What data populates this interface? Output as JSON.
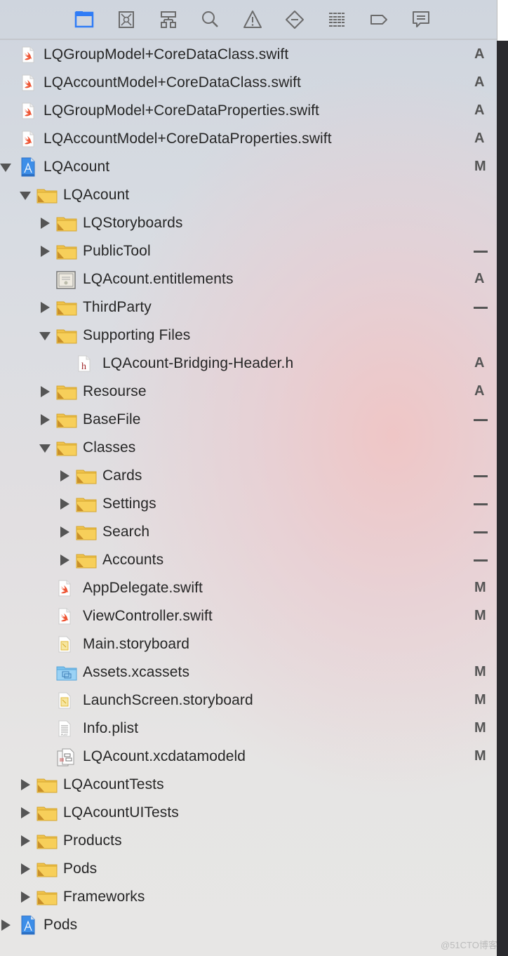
{
  "toolbar": {
    "icons": [
      "folder-icon",
      "source-control-icon",
      "hierarchy-icon",
      "search-icon",
      "warning-icon",
      "test-icon",
      "debug-icon",
      "breakpoint-icon",
      "report-icon"
    ],
    "active": 0,
    "accent": "#2f7cf6"
  },
  "tree": [
    {
      "label": "LQGroupModel+CoreDataClass.swift",
      "level": 0,
      "type": "swift",
      "status": "A"
    },
    {
      "label": "LQAccountModel+CoreDataClass.swift",
      "level": 0,
      "type": "swift",
      "status": "A"
    },
    {
      "label": "LQGroupModel+CoreDataProperties.swift",
      "level": 0,
      "type": "swift",
      "status": "A"
    },
    {
      "label": "LQAccountModel+CoreDataProperties.swift",
      "level": 0,
      "type": "swift",
      "status": "A"
    },
    {
      "label": "LQAcount",
      "level": 0,
      "type": "project",
      "disclosure": "open",
      "status": "M",
      "root": true
    },
    {
      "label": "LQAcount",
      "level": 1,
      "type": "folder",
      "disclosure": "open",
      "status": ""
    },
    {
      "label": "LQStoryboards",
      "level": 2,
      "type": "folder",
      "disclosure": "closed",
      "status": ""
    },
    {
      "label": "PublicTool",
      "level": 2,
      "type": "folder",
      "disclosure": "closed",
      "status": "—"
    },
    {
      "label": "LQAcount.entitlements",
      "level": 2,
      "type": "cert",
      "status": "A"
    },
    {
      "label": "ThirdParty",
      "level": 2,
      "type": "folder",
      "disclosure": "closed",
      "status": "—"
    },
    {
      "label": "Supporting Files",
      "level": 2,
      "type": "folder",
      "disclosure": "open",
      "status": ""
    },
    {
      "label": "LQAcount-Bridging-Header.h",
      "level": 3,
      "type": "header",
      "status": "A"
    },
    {
      "label": "Resourse",
      "level": 2,
      "type": "folder",
      "disclosure": "closed",
      "status": "A"
    },
    {
      "label": "BaseFile",
      "level": 2,
      "type": "folder",
      "disclosure": "closed",
      "status": "—"
    },
    {
      "label": "Classes",
      "level": 2,
      "type": "folder",
      "disclosure": "open",
      "status": ""
    },
    {
      "label": "Cards",
      "level": 3,
      "type": "folder",
      "disclosure": "closed",
      "status": "—"
    },
    {
      "label": "Settings",
      "level": 3,
      "type": "folder",
      "disclosure": "closed",
      "status": "—"
    },
    {
      "label": "Search",
      "level": 3,
      "type": "folder",
      "disclosure": "closed",
      "status": "—"
    },
    {
      "label": "Accounts",
      "level": 3,
      "type": "folder",
      "disclosure": "closed",
      "status": "—"
    },
    {
      "label": "AppDelegate.swift",
      "level": 2,
      "type": "swift",
      "status": "M"
    },
    {
      "label": "ViewController.swift",
      "level": 2,
      "type": "swift",
      "status": "M"
    },
    {
      "label": "Main.storyboard",
      "level": 2,
      "type": "storyboard",
      "status": ""
    },
    {
      "label": "Assets.xcassets",
      "level": 2,
      "type": "assets",
      "status": "M"
    },
    {
      "label": "LaunchScreen.storyboard",
      "level": 2,
      "type": "storyboard",
      "status": "M"
    },
    {
      "label": "Info.plist",
      "level": 2,
      "type": "plist",
      "status": "M"
    },
    {
      "label": "LQAcount.xcdatamodeld",
      "level": 2,
      "type": "datamodel",
      "status": "M"
    },
    {
      "label": "LQAcountTests",
      "level": 1,
      "type": "folder",
      "disclosure": "closed",
      "status": ""
    },
    {
      "label": "LQAcountUITests",
      "level": 1,
      "type": "folder",
      "disclosure": "closed",
      "status": ""
    },
    {
      "label": "Products",
      "level": 1,
      "type": "folder",
      "disclosure": "closed",
      "status": ""
    },
    {
      "label": "Pods",
      "level": 1,
      "type": "folder",
      "disclosure": "closed",
      "status": ""
    },
    {
      "label": "Frameworks",
      "level": 1,
      "type": "folder",
      "disclosure": "closed",
      "status": ""
    },
    {
      "label": "Pods",
      "level": 0,
      "type": "project",
      "disclosure": "closed",
      "status": "",
      "root": true
    }
  ],
  "watermark": "@51CTO博客"
}
